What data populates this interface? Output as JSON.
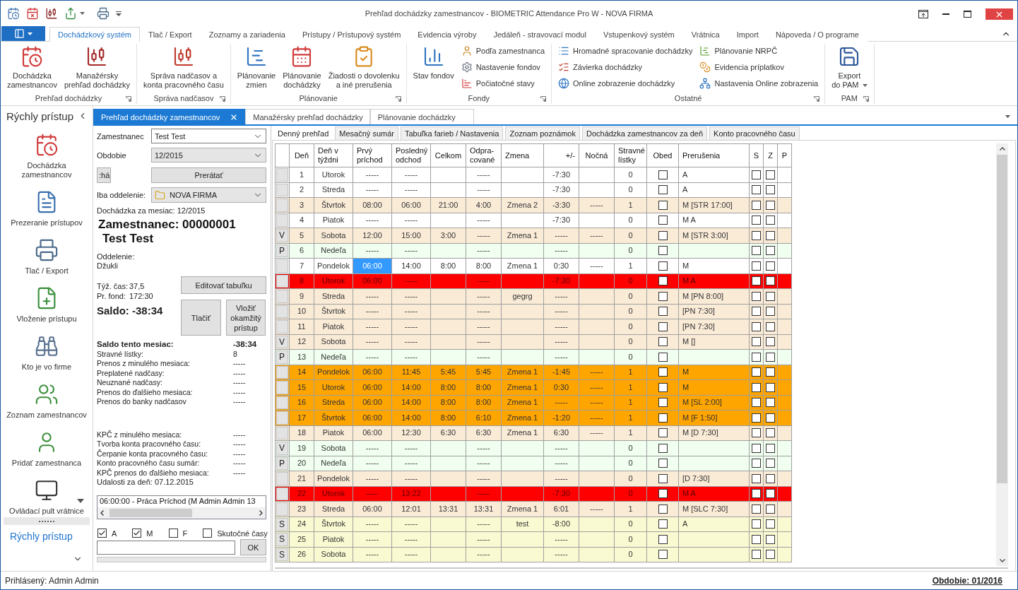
{
  "window": {
    "title": "Prehľad dochádzky zamestnancov - BIOMETRIC Attendance Pro W - NOVA FIRMA"
  },
  "ribbon": {
    "tabs": [
      {
        "label": "Dochádzkový systém",
        "selected": true
      },
      {
        "label": "Tlač / Export",
        "selected": false
      },
      {
        "label": "Zoznamy a zariadenia",
        "selected": false
      },
      {
        "label": "Prístupy / Prístupový systém",
        "selected": false
      },
      {
        "label": "Evidencia výroby",
        "selected": false
      },
      {
        "label": "Jedáleň - stravovací modul",
        "selected": false
      },
      {
        "label": "Vstupenkový systém",
        "selected": false
      },
      {
        "label": "Vrátnica",
        "selected": false
      },
      {
        "label": "Import",
        "selected": false
      },
      {
        "label": "Nápoveda / O programe",
        "selected": false
      }
    ],
    "groups": [
      {
        "label": "Prehľad dochádzky",
        "buttons": [
          {
            "kind": "large",
            "label": "Dochádzka\nzamestnancov"
          },
          {
            "kind": "large",
            "label": "Manažérsky\nprehľad dochádzky"
          }
        ]
      },
      {
        "label": "Správa nadčasov",
        "buttons": [
          {
            "kind": "large",
            "label": "Správa nadčasov a\nkonta pracovného času"
          }
        ]
      },
      {
        "label": "Plánovanie",
        "buttons": [
          {
            "kind": "large",
            "label": "Plánovanie\nzmien"
          },
          {
            "kind": "large",
            "label": "Plánovanie\ndochádzky"
          },
          {
            "kind": "large",
            "label": "Žiadosti o dovolenku\na iné prerušenia"
          }
        ]
      },
      {
        "label": "Fondy",
        "buttons": [
          {
            "kind": "large",
            "label": "Stav fondov"
          },
          {
            "kind": "small",
            "label": "Podľa zamestnanca"
          },
          {
            "kind": "small",
            "label": "Nastavenie fondov"
          },
          {
            "kind": "small",
            "label": "Počiatočné stavy"
          }
        ]
      },
      {
        "label": "Ostatné",
        "buttons": [
          {
            "kind": "small",
            "label": "Hromadné spracovanie dochádzky"
          },
          {
            "kind": "small",
            "label": "Závierka dochádzky"
          },
          {
            "kind": "small",
            "label": "Online zobrazenie dochádzky"
          },
          {
            "kind": "small",
            "label": "Plánovanie NRPČ"
          },
          {
            "kind": "small",
            "label": "Evidencia príplatkov"
          },
          {
            "kind": "small",
            "label": "Nastavenia Online zobrazenia"
          }
        ]
      },
      {
        "label": "PAM",
        "buttons": [
          {
            "kind": "menu",
            "label": "Export\ndo PAM"
          }
        ]
      }
    ]
  },
  "sidebar": {
    "title": "Rýchly prístup",
    "items": [
      "Dochádzka\nzamestnancov",
      "Prezeranie prístupov",
      "Tlač / Export",
      "Vloženie prístupu",
      "Kto je vo firme",
      "Zoznam zamestnancov",
      "Pridať zamestnanca",
      "Ovládací pult vrátnice"
    ],
    "footer_link": "Rýchly prístup"
  },
  "document_tabs": [
    {
      "label": "Prehľad dochádzky zamestnancov",
      "selected": true
    },
    {
      "label": "Manažérsky prehľad dochádzky",
      "selected": false
    },
    {
      "label": "Plánovanie dochádzky",
      "selected": false
    }
  ],
  "employee_panel": {
    "employee": {
      "label": "Zamestnanec",
      "value": "Test Test"
    },
    "period": {
      "label": "Obdobie",
      "value": "12/2015"
    },
    "find_button": ":há",
    "recalculate_button": "Prerátať",
    "department_filter": {
      "label": "Iba oddelenie:",
      "value": "NOVA FIRMA"
    },
    "month_caption": "Dochádzka za mesiac: 12/2015",
    "employee_title": "Zamestnanec: 00000001",
    "employee_name": "Test Test",
    "department_caption": "Oddelenie:",
    "department_name": "Džukli",
    "weekly_time": {
      "label": "Týž. čas:",
      "value": "37,5"
    },
    "fund": {
      "label": "Pr. fond:",
      "value": "172:30"
    },
    "balance": "Saldo: -38:34",
    "edit_button": "Editovať tabuľku",
    "print_button": "Tlačiť",
    "insert_button": "Vložiť okamžitý prístup",
    "summary": [
      {
        "kind": "total",
        "label": "Saldo tento mesiac:",
        "value": "-38:34"
      },
      {
        "kind": "line",
        "label": "Stravné lístky:",
        "value": "8"
      },
      {
        "kind": "line",
        "label": "Prenos z minulého mesiaca:",
        "value": "-----"
      },
      {
        "kind": "line",
        "label": "Preplatené nadčasy:",
        "value": "-----"
      },
      {
        "kind": "line",
        "label": "Neuznané nadčasy:",
        "value": "-----"
      },
      {
        "kind": "line",
        "label": "Prenos do ďalšieho mesiaca:",
        "value": "-----"
      },
      {
        "kind": "line",
        "label": "Prenos do banky nadčasov",
        "value": "-----"
      }
    ],
    "work_account": [
      {
        "label": "KPČ z minulého mesiaca:",
        "value": "-----"
      },
      {
        "label": "Tvorba konta pracovného času:",
        "value": "-----"
      },
      {
        "label": "Čerpanie konta pracovného času:",
        "value": "-----"
      },
      {
        "label": "Konto pracovného času sumár:",
        "value": "-----"
      },
      {
        "label": "KPČ prenos do ďalšieho mesiaca:",
        "value": "-----"
      }
    ],
    "events_caption": "Udalosti za deň: 07.12.2015",
    "events": [
      "06:00:00 - Práca Príchod (M Admin Admin  13"
    ],
    "filters": [
      {
        "label": "A",
        "checked": true
      },
      {
        "label": "M",
        "checked": true
      },
      {
        "label": "F",
        "checked": false
      },
      {
        "label": "Skutočné časy",
        "checked": false
      }
    ],
    "ok_button": "OK"
  },
  "view_tabs": [
    {
      "label": "Denný prehľad",
      "selected": true
    },
    {
      "label": "Mesačný sumár",
      "selected": false
    },
    {
      "label": "Tabuľka farieb / Nastavenia",
      "selected": false
    },
    {
      "label": "Zoznam poznámok",
      "selected": false
    },
    {
      "label": "Dochádzka zamestnancov za deň",
      "selected": false
    },
    {
      "label": "Konto pracovného času",
      "selected": false
    }
  ],
  "table": {
    "columns": [
      "Deň",
      "Deň v\ntýždni",
      "Prvý\npríchod",
      "Posledný\nodchod",
      "Celkom",
      "Odpra-\ncované",
      "Zmena",
      "+/-",
      "Nočná",
      "Stravné\nlístky",
      "Obed",
      "Prerušenia",
      "S",
      "Z",
      "P"
    ],
    "rows": [
      {
        "day": "1",
        "weekday": "Utorok",
        "first_in": "-----",
        "last_out": "-----",
        "worked": "-----",
        "balance": "-7:30",
        "meals": "0",
        "lunch": false,
        "breaks": "A",
        "s": false,
        "z": false,
        "color": "#ffffff",
        "selected": false
      },
      {
        "day": "2",
        "weekday": "Streda",
        "first_in": "-----",
        "last_out": "-----",
        "worked": "-----",
        "balance": "-7:30",
        "meals": "0",
        "lunch": false,
        "breaks": "A",
        "s": false,
        "z": false,
        "color": "#ffffff",
        "selected": false
      },
      {
        "day": "3",
        "weekday": "Štvrtok",
        "first_in": "08:00",
        "last_out": "06:00",
        "total": "21:00",
        "worked": "4:00",
        "shift": "Zmena 2",
        "balance": "-3:30",
        "night": "-----",
        "meals": "1",
        "lunch": false,
        "breaks": "M [STR 17:00]",
        "s": false,
        "z": false,
        "color": "#faebd7",
        "selected": false
      },
      {
        "day": "4",
        "weekday": "Piatok",
        "first_in": "-----",
        "last_out": "-----",
        "worked": "-----",
        "balance": "-7:30",
        "meals": "0",
        "lunch": false,
        "breaks": "M A",
        "s": false,
        "z": false,
        "color": "#ffffff",
        "selected": false
      },
      {
        "marker": "V",
        "day": "5",
        "weekday": "Sobota",
        "first_in": "12:00",
        "last_out": "15:00",
        "total": "3:00",
        "worked": "-----",
        "shift": "Zmena 1",
        "balance": "-----",
        "night": "-----",
        "meals": "0",
        "lunch": false,
        "breaks": "M [STR 3:00]",
        "s": false,
        "z": false,
        "color": "#faebd7",
        "selected": false
      },
      {
        "marker": "P",
        "day": "6",
        "weekday": "Nedeľa",
        "first_in": "-----",
        "last_out": "-----",
        "worked": "-----",
        "balance": "-----",
        "meals": "0",
        "lunch": false,
        "s": false,
        "z": false,
        "color": "#f0fff0",
        "selected": false
      },
      {
        "day": "7",
        "weekday": "Pondelok",
        "first_in": "06:00",
        "last_out": "14:00",
        "total": "8:00",
        "worked": "8:00",
        "shift": "Zmena 1",
        "balance": "0:30",
        "night": "-----",
        "meals": "1",
        "lunch": false,
        "breaks": "M",
        "s": false,
        "z": false,
        "color": "#ffffff",
        "selected": true
      },
      {
        "day": "8",
        "weekday": "Utorok",
        "first_in": "06:00",
        "last_out": "-----",
        "worked": "-----",
        "balance": "-7:30",
        "meals": "0",
        "lunch": false,
        "breaks": "M A",
        "s": false,
        "z": false,
        "color": "#ff0000",
        "selected": false
      },
      {
        "day": "9",
        "weekday": "Streda",
        "first_in": "-----",
        "last_out": "-----",
        "worked": "-----",
        "shift": "gegrg",
        "balance": "-----",
        "meals": "0",
        "lunch": false,
        "breaks": "M [PN 8:00]",
        "s": false,
        "z": false,
        "color": "#faebd7",
        "selected": false
      },
      {
        "day": "10",
        "weekday": "Štvrtok",
        "first_in": "-----",
        "last_out": "-----",
        "worked": "-----",
        "balance": "-----",
        "meals": "0",
        "lunch": false,
        "breaks": "[PN 7:30]",
        "s": false,
        "z": false,
        "color": "#faebd7",
        "selected": false
      },
      {
        "day": "11",
        "weekday": "Piatok",
        "first_in": "-----",
        "last_out": "-----",
        "worked": "-----",
        "balance": "-----",
        "meals": "0",
        "lunch": false,
        "breaks": "[PN 7:30]",
        "s": false,
        "z": false,
        "color": "#faebd7",
        "selected": false
      },
      {
        "marker": "V",
        "day": "12",
        "weekday": "Sobota",
        "first_in": "-----",
        "last_out": "-----",
        "worked": "-----",
        "balance": "-----",
        "meals": "0",
        "lunch": false,
        "breaks": "M []",
        "s": false,
        "z": false,
        "color": "#faebd7",
        "selected": false
      },
      {
        "marker": "P",
        "day": "13",
        "weekday": "Nedeľa",
        "first_in": "-----",
        "last_out": "-----",
        "worked": "-----",
        "balance": "-----",
        "meals": "0",
        "lunch": false,
        "s": false,
        "z": false,
        "color": "#f0fff0",
        "selected": false
      },
      {
        "day": "14",
        "weekday": "Pondelok",
        "first_in": "06:00",
        "last_out": "11:45",
        "total": "5:45",
        "worked": "5:45",
        "shift": "Zmena 1",
        "balance": "-1:45",
        "night": "-----",
        "meals": "1",
        "lunch": false,
        "breaks": "M",
        "s": false,
        "z": false,
        "color": "#ffa500",
        "selected": false
      },
      {
        "day": "15",
        "weekday": "Utorok",
        "first_in": "06:00",
        "last_out": "14:00",
        "total": "8:00",
        "worked": "8:00",
        "shift": "Zmena 1",
        "balance": "0:30",
        "night": "-----",
        "meals": "1",
        "lunch": false,
        "breaks": "M",
        "s": false,
        "z": false,
        "color": "#ffa500",
        "selected": false
      },
      {
        "day": "16",
        "weekday": "Streda",
        "first_in": "06:00",
        "last_out": "14:00",
        "total": "8:00",
        "worked": "8:00",
        "shift": "Zmena 1",
        "balance": "-----",
        "night": "-----",
        "meals": "1",
        "lunch": false,
        "breaks": "M [SL 2:00]",
        "s": false,
        "z": false,
        "color": "#ffa500",
        "selected": false
      },
      {
        "day": "17",
        "weekday": "Štvrtok",
        "first_in": "06:00",
        "last_out": "14:00",
        "total": "8:00",
        "worked": "6:10",
        "shift": "Zmena 1",
        "balance": "-1:20",
        "night": "-----",
        "meals": "1",
        "lunch": false,
        "breaks": "M [F 1:50]",
        "s": false,
        "z": false,
        "color": "#ffa500",
        "selected": false
      },
      {
        "day": "18",
        "weekday": "Piatok",
        "first_in": "06:00",
        "last_out": "12:30",
        "total": "6:30",
        "worked": "6:30",
        "shift": "Zmena 1",
        "balance": "6:30",
        "night": "-----",
        "meals": "1",
        "lunch": false,
        "breaks": "M [D 7:30]",
        "s": false,
        "z": false,
        "color": "#faebd7",
        "selected": false
      },
      {
        "marker": "V",
        "day": "19",
        "weekday": "Sobota",
        "first_in": "-----",
        "last_out": "-----",
        "worked": "-----",
        "balance": "-----",
        "meals": "0",
        "lunch": false,
        "s": false,
        "z": false,
        "color": "#f0fff0",
        "selected": false
      },
      {
        "marker": "P",
        "day": "20",
        "weekday": "Nedeľa",
        "first_in": "-----",
        "last_out": "-----",
        "worked": "-----",
        "balance": "-----",
        "meals": "0",
        "lunch": false,
        "s": false,
        "z": false,
        "color": "#f0fff0",
        "selected": false
      },
      {
        "day": "21",
        "weekday": "Pondelok",
        "first_in": "-----",
        "last_out": "-----",
        "worked": "-----",
        "balance": "-----",
        "meals": "0",
        "lunch": false,
        "breaks": "[D 7:30]",
        "s": false,
        "z": false,
        "color": "#faebd7",
        "selected": false
      },
      {
        "day": "22",
        "weekday": "Utorok",
        "first_in": "-----",
        "last_out": "13:22",
        "worked": "-----",
        "balance": "-7:30",
        "meals": "0",
        "lunch": false,
        "breaks": "M A",
        "s": false,
        "z": false,
        "color": "#ff0000",
        "selected": false
      },
      {
        "day": "23",
        "weekday": "Streda",
        "first_in": "06:00",
        "last_out": "12:01",
        "total": "13:31",
        "worked": "13:31",
        "shift": "Zmena 1",
        "balance": "6:01",
        "night": "-----",
        "meals": "1",
        "lunch": false,
        "breaks": "M [SLC 7:30]",
        "s": false,
        "z": false,
        "color": "#faebd7",
        "selected": false
      },
      {
        "marker": "S",
        "day": "24",
        "weekday": "Štvrtok",
        "first_in": "-----",
        "last_out": "-----",
        "worked": "-----",
        "shift": "test",
        "balance": "-8:00",
        "meals": "0",
        "lunch": false,
        "breaks": "A",
        "s": false,
        "z": false,
        "color": "#fafad2",
        "selected": false
      },
      {
        "marker": "S",
        "day": "25",
        "weekday": "Piatok",
        "first_in": "-----",
        "last_out": "-----",
        "worked": "-----",
        "balance": "-----",
        "meals": "0",
        "lunch": false,
        "s": false,
        "z": false,
        "color": "#fafad2",
        "selected": false
      },
      {
        "marker": "S",
        "day": "26",
        "weekday": "Sobota",
        "first_in": "-----",
        "last_out": "-----",
        "worked": "-----",
        "balance": "-----",
        "meals": "0",
        "lunch": false,
        "s": false,
        "z": false,
        "color": "#fafad2",
        "selected": false
      }
    ]
  },
  "status_bar": {
    "user": "Prihlásený: Admin Admin",
    "period": "Obdobie: 01/2016"
  }
}
